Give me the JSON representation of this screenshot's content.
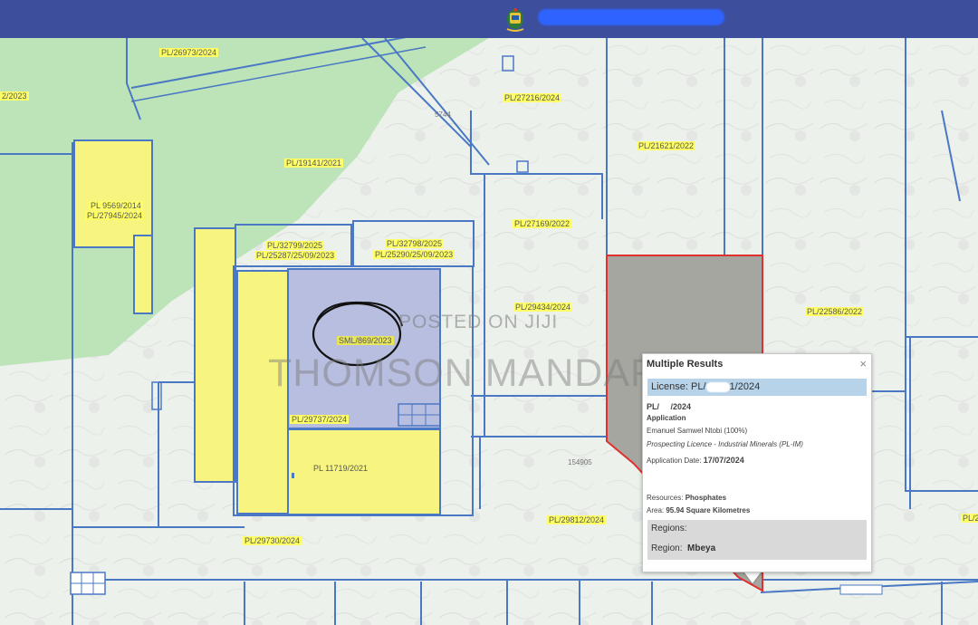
{
  "map": {
    "parcel_labels": [
      {
        "text": "PL/26973/2024"
      },
      {
        "text": "2/2023"
      },
      {
        "text": "PL/27216/2024"
      },
      {
        "text": "PL/21621/2022"
      },
      {
        "text": "PL/19141/2021"
      },
      {
        "text": "PL 9569/2014"
      },
      {
        "text": "PL/27945/2024"
      },
      {
        "text": "PL/27169/2022"
      },
      {
        "text": "PL/32799/2025"
      },
      {
        "text": "PL/25287/25/09/2023"
      },
      {
        "text": "PL/32798/2025"
      },
      {
        "text": "PL/25290/25/09/2023"
      },
      {
        "text": "PL/29434/2024"
      },
      {
        "text": "PL/22586/2022"
      },
      {
        "text": "SML/869/2023"
      },
      {
        "text": "PL/29737/2024"
      },
      {
        "text": "PL 11719/2021"
      },
      {
        "text": "PL/29812/2024"
      },
      {
        "text": "PL/29730/2024"
      },
      {
        "text": "PL/2"
      }
    ],
    "small_text": [
      {
        "text": "5744"
      },
      {
        "text": "154905"
      }
    ],
    "watermark_small": "POSTED ON JIJI",
    "watermark_large": "THOMSON MANDARA"
  },
  "popup": {
    "title": "Multiple Results",
    "close": "×",
    "license_prefix": "License: PL/",
    "license_suffix": "1/2024",
    "pl_prefix": "PL/",
    "pl_suffix": "/2024",
    "application": "Application",
    "holder": "Emanuel Samwel Ntobi (100%)",
    "licence_type": "Prospecting Licence - Industrial Minerals (PL-IM)",
    "app_date_label": "Application Date:",
    "app_date": "17/07/2024",
    "resources_label": "Resources:",
    "resources": "Phosphates",
    "area_label": "Area:",
    "area": "95.94 Square Kilometres",
    "regions_heading": "Regions:",
    "region_label": "Region:",
    "region": "Mbeya"
  },
  "colors": {
    "header": "#3d4e9c",
    "parcel_border": "#4a78c4",
    "green_zone": "#bde3b8",
    "yellow_parcel": "#f7f57f",
    "sml_parcel": "#b8bedf",
    "selected_parcel": "#a6a6a0",
    "selected_border": "#e03030"
  }
}
